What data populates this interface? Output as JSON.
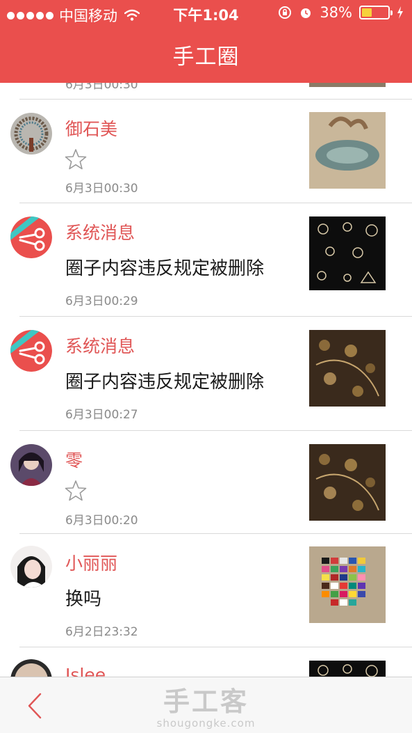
{
  "status_bar": {
    "carrier": "中国移动",
    "time": "下午1:04",
    "battery": "38%",
    "battery_level": 0.38,
    "icons": [
      "signal-dots-icon",
      "wifi-icon",
      "rotation-lock-icon",
      "alarm-icon",
      "battery-icon",
      "charging-bolt-icon"
    ]
  },
  "header": {
    "title": "手工圈"
  },
  "partial_top": {
    "time": "6月3日00:30"
  },
  "feed": [
    {
      "name": "御石美",
      "content": "",
      "has_star": true,
      "time": "6月3日00:30",
      "avatar": "beaded-necklace",
      "thumb": "macrame-bracelet"
    },
    {
      "name": "系统消息",
      "content": "圈子内容违反规定被删除",
      "has_star": false,
      "time": "6月3日00:29",
      "avatar": "scissors-logo",
      "thumb": "metal-charms-black"
    },
    {
      "name": "系统消息",
      "content": "圈子内容违反规定被删除",
      "has_star": false,
      "time": "6月3日00:27",
      "avatar": "scissors-logo",
      "thumb": "bronze-charms"
    },
    {
      "name": "零",
      "content": "",
      "has_star": true,
      "time": "6月3日00:20",
      "avatar": "anime-girl",
      "thumb": "bronze-charms"
    },
    {
      "name": "小丽丽",
      "content": "换吗",
      "has_star": false,
      "time": "6月2日23:32",
      "avatar": "girl-portrait",
      "thumb": "thread-spools"
    }
  ],
  "partial_bottom": {
    "name": "Jslee"
  },
  "tabbar": {
    "back_icon": "back-chevron-icon",
    "watermark_cn": "手工客",
    "watermark_url": "shougongke.com"
  },
  "colors": {
    "accent": "#ea4f4d",
    "name_text": "#e05656",
    "time_text": "#8a8a8a"
  }
}
